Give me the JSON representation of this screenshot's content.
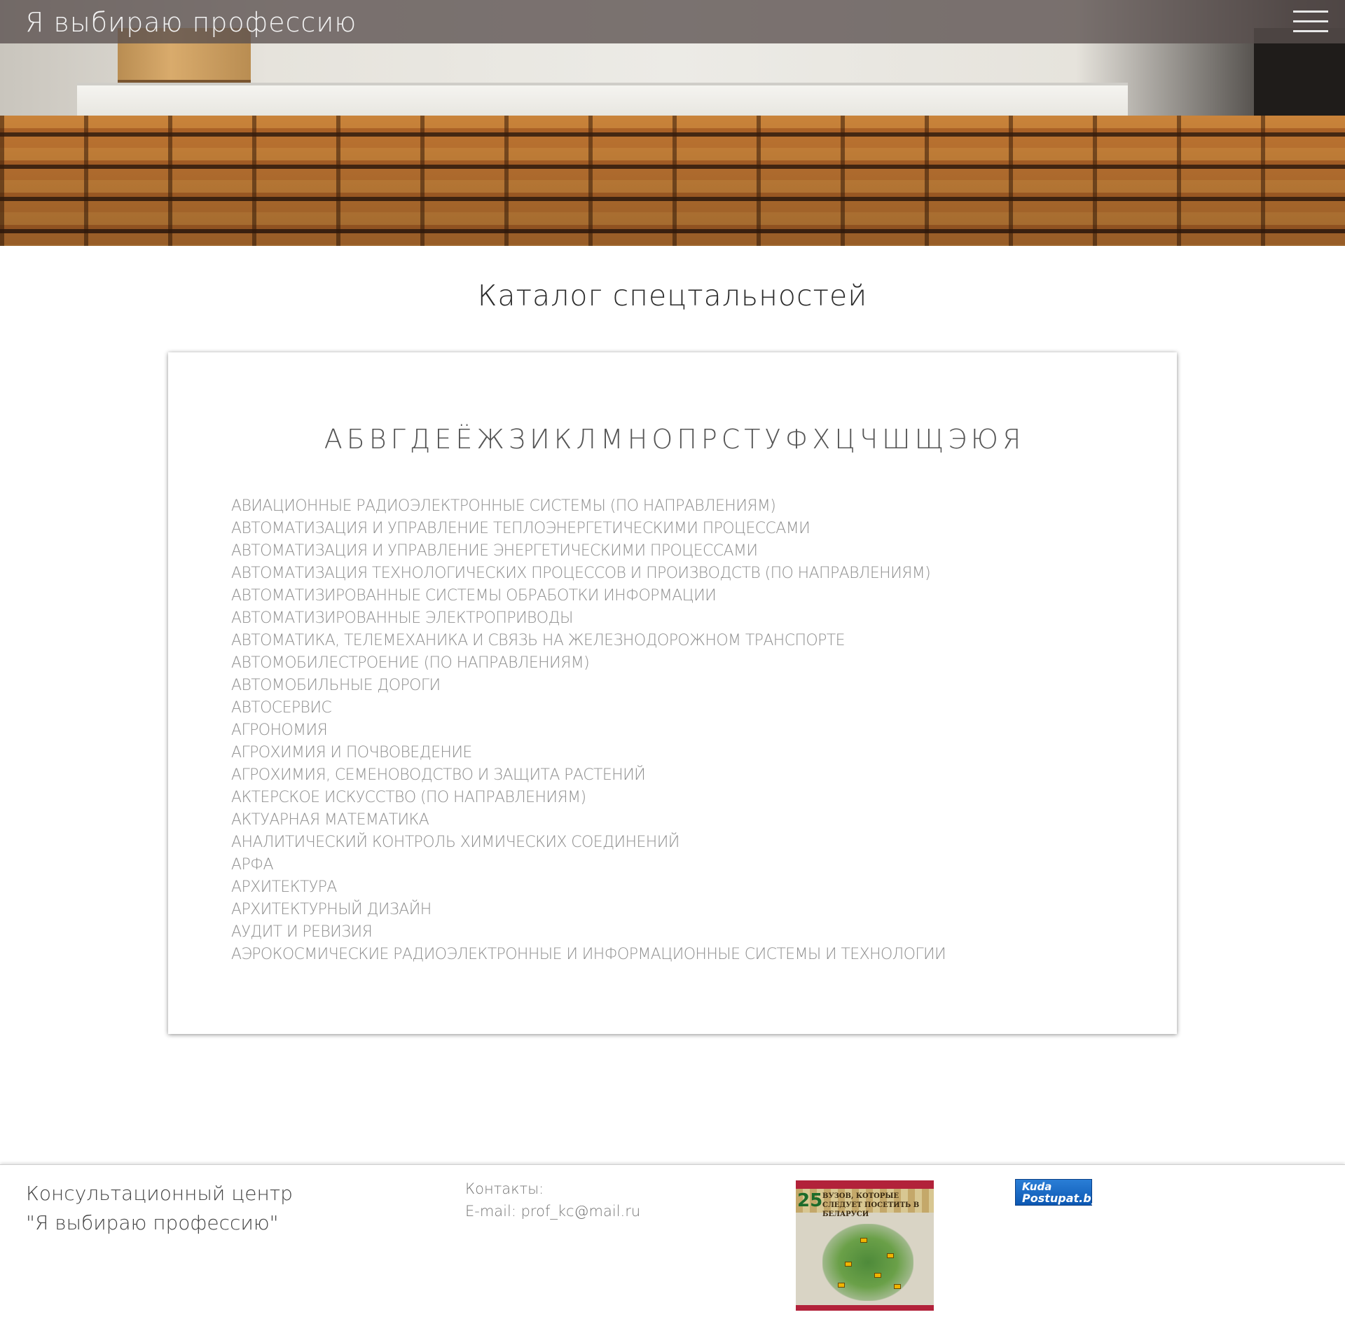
{
  "header": {
    "brand": "Я выбираю профессию",
    "menu_icon": "hamburger-menu-icon"
  },
  "main": {
    "title": "Каталог спецтальностей",
    "alphabet": [
      "А",
      "Б",
      "В",
      "Г",
      "Д",
      "Е",
      "Ё",
      "Ж",
      "З",
      "И",
      "К",
      "Л",
      "М",
      "Н",
      "О",
      "П",
      "Р",
      "С",
      "Т",
      "У",
      "Ф",
      "Х",
      "Ц",
      "Ч",
      "Ш",
      "Щ",
      "Э",
      "Ю",
      "Я"
    ],
    "specialties": [
      "Авиационные радиоэлектронные системы (по направлениям)",
      "Автоматизация и управление теплоэнергетическими процессами",
      "Автоматизация и управление энергетическими процессами",
      "Автоматизация технологических процессов и производств (по направлениям)",
      "Автоматизированные системы обработки информации",
      "Автоматизированные электроприводы",
      "Автоматика, телемеханика и связь на железнодорожном транспорте",
      "Автомобилестроение (по направлениям)",
      "Автомобильные дороги",
      "Автосервис",
      "Агрономия",
      "Агрохимия и почвоведение",
      "Агрохимия, семеноводство и защита растений",
      "Актерское искусство (по направлениям)",
      "Актуарная математика",
      "Аналитический контроль химических соединений",
      "Арфа",
      "Архитектура",
      "Архитектурный дизайн",
      "Аудит и ревизия",
      "Аэрокосмические радиоэлектронные и информационные системы и технологии"
    ]
  },
  "footer": {
    "org_line1": "Консультационный центр",
    "org_line2": "\"Я выбираю профессию\"",
    "contacts_label": "Контакты:",
    "contacts_email": "E-mail: prof_kc@mail.ru",
    "banner_map": {
      "number": "25",
      "text": "ВУЗОВ, КОТОРЫЕ СЛЕДУЕТ ПОСЕТИТЬ В БЕЛАРУСИ"
    },
    "kuda_logo": {
      "line1": "Kuda",
      "line2": "Postupat.by"
    }
  }
}
